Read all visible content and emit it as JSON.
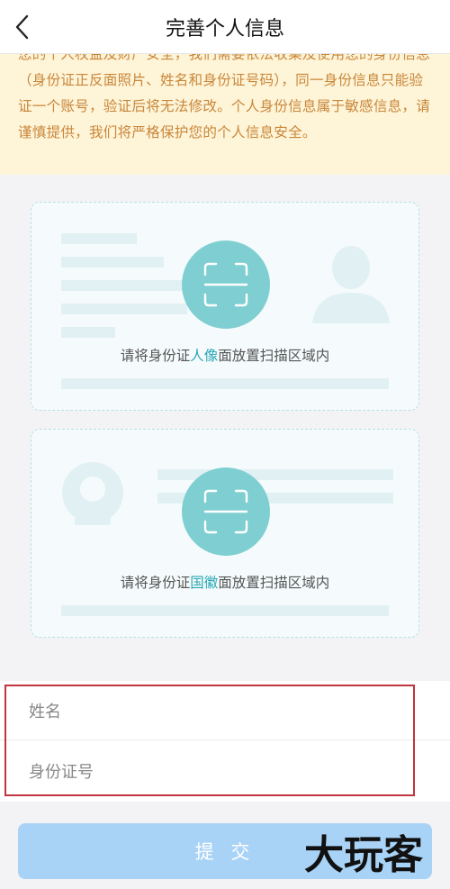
{
  "nav": {
    "back_icon": "chevron-left-icon",
    "title": "完善个人信息"
  },
  "notice": {
    "text": "您的个人权益及财产安全，我们需要依法收集及使用您的身份信息（身份证正反面照片、姓名和身份证号码），同一身份信息只能验证一个账号，验证后将无法修改。个人身份信息属于敏感信息，请谨慎提供，我们将严格保护您的个人信息安全。"
  },
  "id_front": {
    "hint_prefix": "请将身份证",
    "hint_highlight": "人像",
    "hint_suffix": "面放置扫描区域内",
    "icon": "scan-frame-icon"
  },
  "id_back": {
    "hint_prefix": "请将身份证",
    "hint_highlight": "国徽",
    "hint_suffix": "面放置扫描区域内",
    "icon": "scan-frame-icon"
  },
  "form": {
    "name_placeholder": "姓名",
    "id_number_placeholder": "身份证号"
  },
  "submit": {
    "label": "提 交"
  },
  "watermark": {
    "text": "大玩客"
  },
  "colors": {
    "notice_bg": "#fef4d8",
    "notice_text": "#c9873a",
    "highlight": "#2aa7b5",
    "scan_circle": "#7fcfd2",
    "submit_bg": "#a9d3f6",
    "annotation_border": "#c0343d"
  }
}
